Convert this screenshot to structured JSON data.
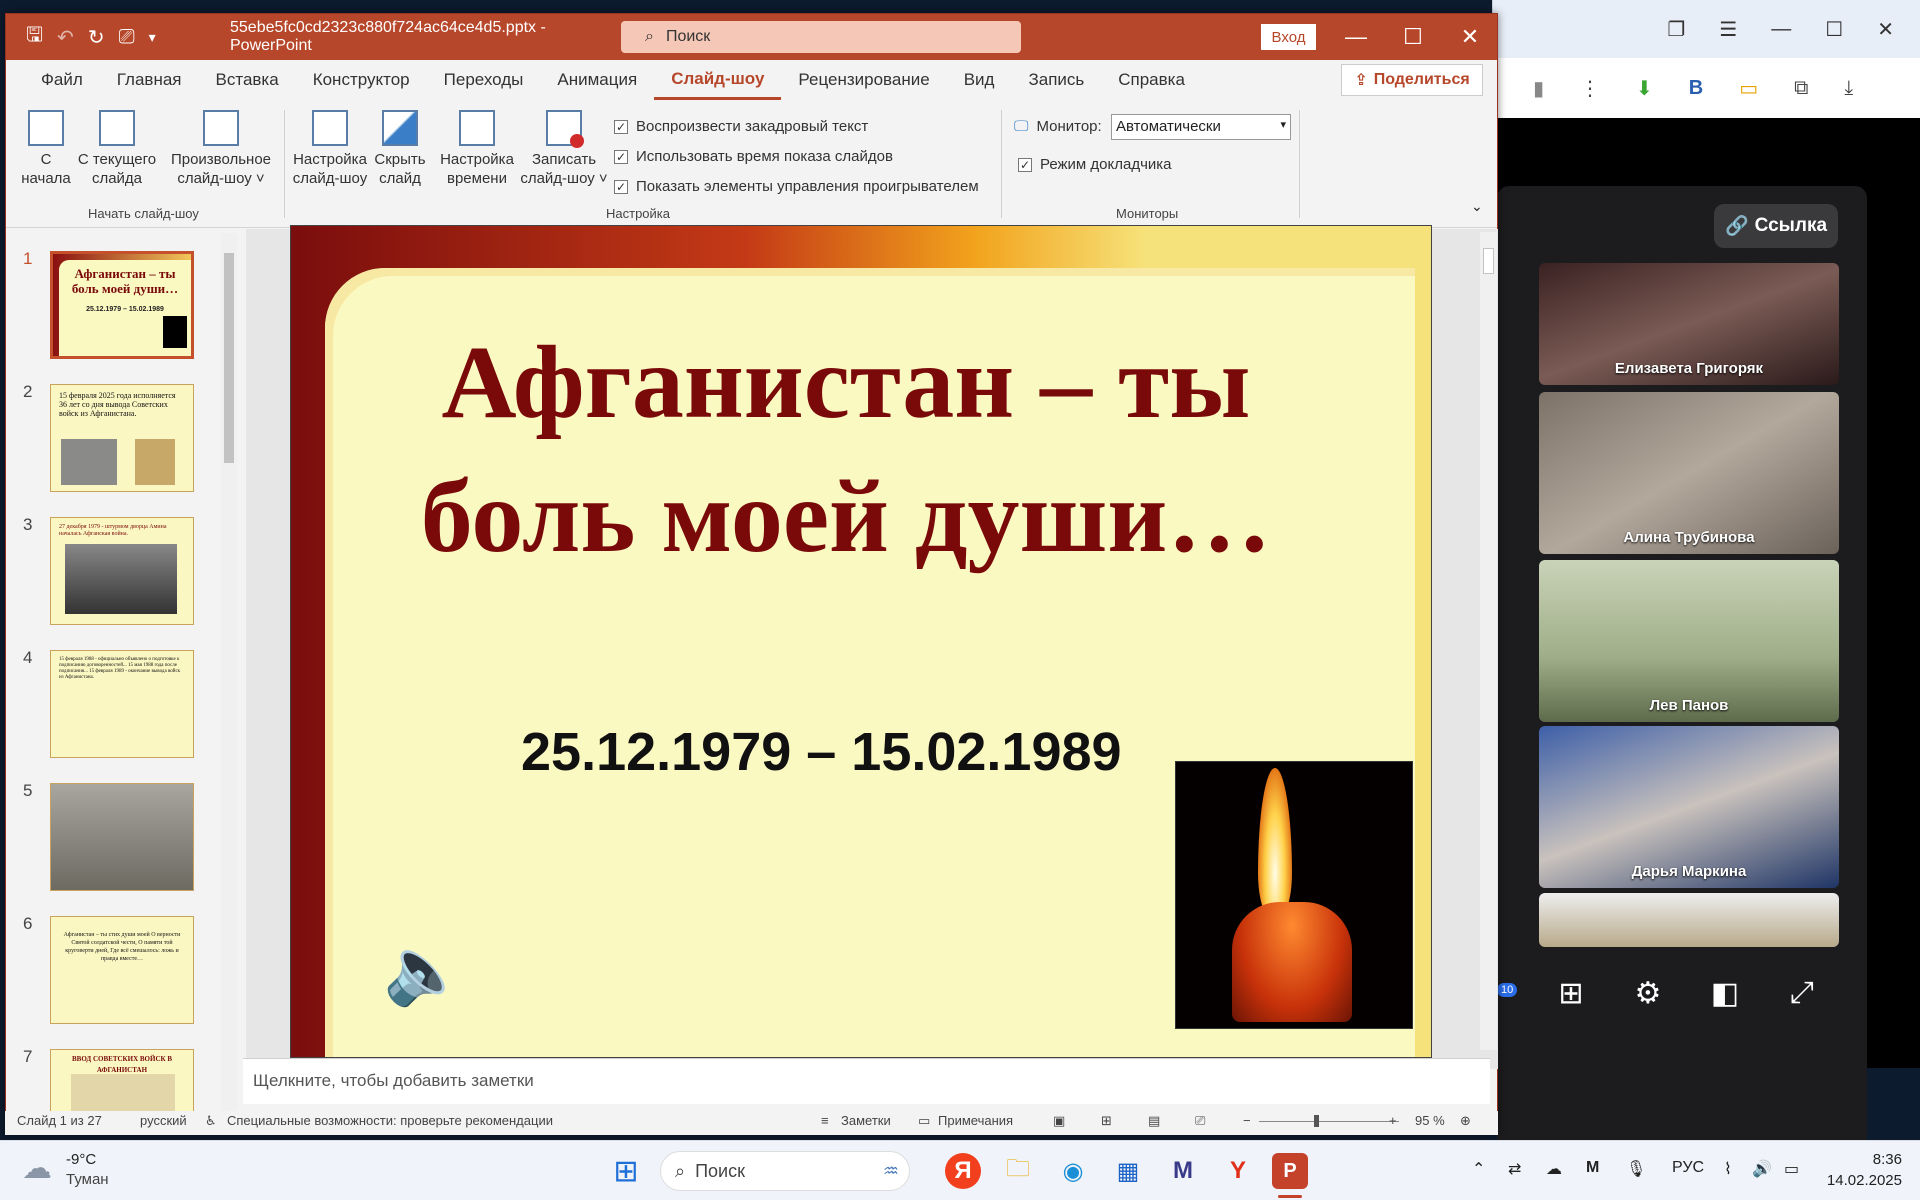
{
  "powerpoint": {
    "file_name": "55ebe5fc0cd2323c880f724ac64ce4d5.pptx",
    "app_sep": "-",
    "app_name": "PowerPoint",
    "search_placeholder": "Поиск",
    "sign_in": "Вход",
    "share": "Поделиться",
    "tabs": [
      "Файл",
      "Главная",
      "Вставка",
      "Конструктор",
      "Переходы",
      "Анимация",
      "Слайд-шоу",
      "Рецензирование",
      "Вид",
      "Запись",
      "Справка"
    ],
    "active_tab": "Слайд-шоу",
    "ribbon": {
      "from_start_1": "С",
      "from_start_2": "начала",
      "from_current_1": "С текущего",
      "from_current_2": "слайда",
      "custom_1": "Произвольное",
      "custom_2": "слайд-шоу ˅",
      "group_start": "Начать слайд-шоу",
      "setup_1": "Настройка",
      "setup_2": "слайд-шоу",
      "hide_1": "Скрыть",
      "hide_2": "слайд",
      "rehearse_1": "Настройка",
      "rehearse_2": "времени",
      "record_1": "Записать",
      "record_2": "слайд-шоу ˅",
      "chk_narration": "Воспроизвести закадровый текст",
      "chk_timings": "Использовать время показа слайдов",
      "chk_media": "Показать элементы управления проигрывателем",
      "group_setup": "Настройка",
      "monitor_label": "Монитор:",
      "monitor_value": "Автоматически",
      "presenter_view": "Режим докладчика",
      "group_monitors": "Мониторы"
    },
    "thumbnails": [
      {
        "num": "1",
        "text": "Афганистан – ты боль моей души…",
        "sub": "25.12.1979 – 15.02.1989"
      },
      {
        "num": "2",
        "text": "15 февраля 2025 года исполняется 36 лет со дня вывода Советских войск из Афганистана."
      },
      {
        "num": "3",
        "text": "27 декабря 1979 - штурмом дворца Амина началась Афганская война."
      },
      {
        "num": "4",
        "text": "15 февраля 1988 - официально объявлено о подготовке к подписанию договоренностей... 15 мая 1988 года после подписания... 15 февраля 1989 - окончание вывода войск из Афганистана."
      },
      {
        "num": "5",
        "text": ""
      },
      {
        "num": "6",
        "text": "Афганистан – ты стих души моей О верности Святой солдатской чести, О памяти той круговерти дней, Где всё смешалось: ложь и правда вместе…"
      },
      {
        "num": "7",
        "text": "ВВОД СОВЕТСКИХ ВОЙСК В АФГАНИСТАН"
      }
    ],
    "slide": {
      "title_line1": "Афганистан – ты",
      "title_line2": "боль моей души…",
      "dates": "25.12.1979 – 15.02.1989"
    },
    "notes_placeholder": "Щелкните, чтобы добавить заметки",
    "status": {
      "slide_counter": "Слайд 1 из 27",
      "language": "русский",
      "accessibility": "Специальные возможности: проверьте рекомендации",
      "notes": "Заметки",
      "comments": "Примечания",
      "zoom": "95 %"
    }
  },
  "meeting": {
    "link_button": "Ссылка",
    "participants": [
      "Елизавета Григоряк",
      "Алина Трубинова",
      "Лев Панов",
      "Дарья Маркина"
    ],
    "badge": "10"
  },
  "taskbar": {
    "weather_temp": "-9°C",
    "weather_desc": "Туман",
    "search": "Поиск",
    "lang": "РУС",
    "time": "8:36",
    "date": "14.02.2025"
  }
}
